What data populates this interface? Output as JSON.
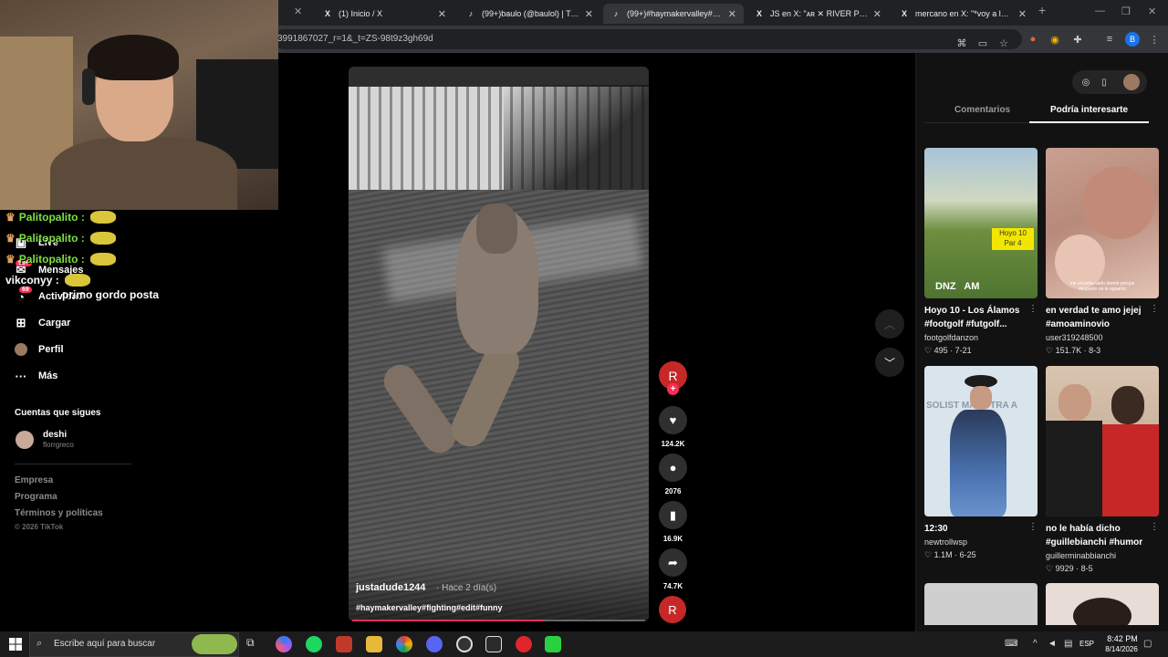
{
  "browser": {
    "tabs": [
      {
        "title": "(1) Inicio / X",
        "favicon": "X"
      },
      {
        "title": "(99+)baulo (@baulol) | TikTok",
        "favicon": "♪"
      },
      {
        "title": "(99+)#haymakervalley#fighting",
        "favicon": "♪"
      },
      {
        "title": "JS en X: \"ᴀʀ ✕ RIVER PLATE RE",
        "favicon": "X"
      },
      {
        "title": "mercano en X: \"*voy a la comp",
        "favicon": "X"
      }
    ],
    "url": "3991867027_r=1&_t=ZS-98t9z3gh69d"
  },
  "chat": [
    {
      "user": "Palitopalito :",
      "message": ""
    },
    {
      "user": "Palitopalito :",
      "message": ""
    },
    {
      "user": "Palitopalito :",
      "message": ""
    },
    {
      "user": "vikconyy :",
      "message": ""
    },
    {
      "user": "",
      "message": "primo gordo posta"
    }
  ],
  "sidebar": {
    "items": [
      {
        "label": "Live",
        "icon": "live-icon"
      },
      {
        "label": "Mensajes",
        "icon": "messages-icon",
        "badge": "99+"
      },
      {
        "label": "Actividad",
        "icon": "activity-icon",
        "badge": "69"
      },
      {
        "label": "Cargar",
        "icon": "upload-icon"
      },
      {
        "label": "Perfil",
        "icon": "profile-icon"
      },
      {
        "label": "Más",
        "icon": "more-icon"
      }
    ],
    "following_title": "Cuentas que sigues",
    "following": [
      {
        "name": "deshi",
        "handle": "florrgreco"
      }
    ],
    "footer": [
      "Empresa",
      "Programa",
      "Términos y políticas"
    ],
    "copyright": "© 2026 TikTok"
  },
  "video": {
    "author": "justadude1244",
    "posted": "· Hace 2 día(s)",
    "hashtags": "#haymakervalley#fighting#edit#funny",
    "progress": 0.65,
    "creator_initial": "R",
    "likes": "124.2K",
    "comments": "2076",
    "saves": "16.9K",
    "shares": "74.7K"
  },
  "right_panel": {
    "tabs": [
      "Comentarios",
      "Podría interesarte"
    ],
    "active_tab": "Podría interesarte",
    "cards": [
      {
        "title": "Hoyo 10 - Los Álamos #footgolf #futgolf...",
        "user": "footgolfdanzon",
        "likes": "495",
        "date": "7-21",
        "thumb_text": "Hoyo 10\nPar 4",
        "thumb_caption": "DNZ   AM"
      },
      {
        "title": "en verdad te amo jejej #amoaminovio",
        "user": "user319248500",
        "likes": "151.7K",
        "date": "8-3",
        "thumb_caption": "me encanta verlo dormir porque despierto no le aguanto"
      },
      {
        "title": "12:30",
        "user": "newtrollwsp",
        "likes": "1.1M",
        "date": "6-25",
        "thumb_text": "SOLIST MALA TRA A"
      },
      {
        "title": "no le había dicho #guillebianchi #humor",
        "user": "guillerminabbianchi",
        "likes": "9929",
        "date": "8-5"
      }
    ]
  },
  "taskbar": {
    "search_placeholder": "Escribe aquí para buscar",
    "time": "8:42 PM",
    "date": "8/14/2026",
    "language": "ESP"
  },
  "colors": {
    "accent": "#fe2c55",
    "chat_name": "#7fe040",
    "background": "#000000"
  }
}
